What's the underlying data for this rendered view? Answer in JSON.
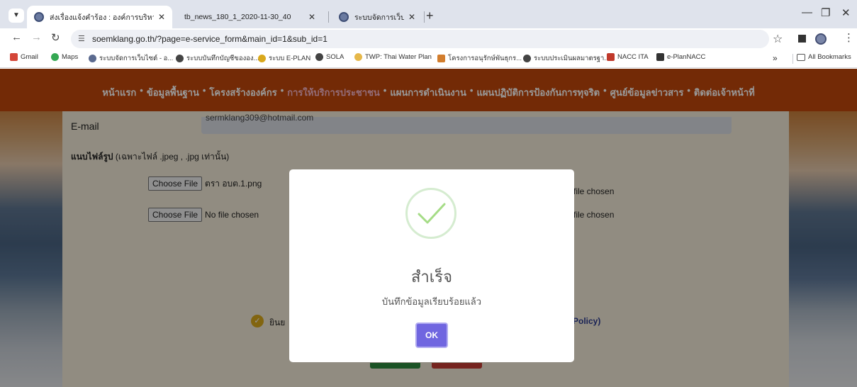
{
  "browser": {
    "tabs": [
      {
        "title": "ส่งเรื่องแจ้งคำร้อง : องค์การบริหารส่วน",
        "active": true
      },
      {
        "title": "tb_news_180_1_2020-11-30_40",
        "active": false
      },
      {
        "title": "ระบบจัดการเว็บไซต์ - องค์การบริหาร",
        "active": false
      }
    ],
    "new_tab": "+",
    "url": "soemklang.go.th/?page=e-service_form&main_id=1&sub_id=1",
    "bookmarks": [
      "Gmail",
      "Maps",
      "ระบบจัดการเว็บไซต์ - อ...",
      "ระบบบันทึกบัญชีขององ...",
      "ระบบ E-PLAN",
      "SOLA",
      "TWP: Thai Water Plan",
      "โครงการอนุรักษ์พันธุกร...",
      "ระบบประเมินผลมาตรฐา...",
      "NACC ITA",
      "e-PlanNACC"
    ],
    "more_bookmarks": "»",
    "all_bookmarks": "All Bookmarks"
  },
  "site": {
    "menu": [
      "หน้าแรก",
      "ข้อมูลพื้นฐาน",
      "โครงสร้างองค์กร",
      "การให้บริการประชาชน",
      "แผนการดำเนินงาน",
      "แผนปฏิบัติการป้องกันการทุจริต",
      "ศูนย์ข้อมูลข่าวสาร",
      "ติดต่อเจ้าหน้าที่"
    ],
    "menu_separator": "•",
    "active_menu_index": 3
  },
  "form": {
    "email_label": "E-mail",
    "email_value": "sermklang309@hotmail.com",
    "attach_title": "แนบไฟล์รูป",
    "attach_note": " (เฉพาะไฟล์ .jpeg , .jpg เท่านั้น)",
    "choose_file": "Choose File",
    "file1": "ตรา อบต.1.png",
    "file2": "No file chosen",
    "file_right": "file chosen",
    "consent_prefix": "ยินย",
    "policy_suffix": "Policy)"
  },
  "dialog": {
    "title": "สำเร็จ",
    "message": "บันทึกข้อมูลเรียบร้อยแล้ว",
    "ok_label": "OK"
  }
}
